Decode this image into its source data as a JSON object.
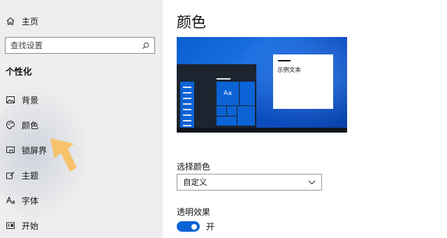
{
  "sidebar": {
    "home_label": "主页",
    "search": {
      "placeholder": "查找设置",
      "value": ""
    },
    "section_title": "个性化",
    "items": [
      {
        "label": "背景",
        "icon": "image-icon"
      },
      {
        "label": "颜色",
        "icon": "palette-icon"
      },
      {
        "label": "锁屏界",
        "icon": "lock-screen-icon"
      },
      {
        "label": "主题",
        "icon": "brush-icon"
      },
      {
        "label": "字体",
        "icon": "font-icon"
      },
      {
        "label": "开始",
        "icon": "start-icon"
      }
    ]
  },
  "main": {
    "title": "颜色",
    "preview": {
      "sample_text": "示例文本",
      "tile_text": "Aa"
    },
    "choose_color": {
      "label": "选择颜色",
      "selected": "自定义"
    },
    "transparency": {
      "label": "透明效果",
      "state": "开",
      "on": true
    }
  },
  "colors": {
    "accent": "#0b63d6",
    "sidebar_bg": "#eeeeee",
    "arrow": "#f6c26b"
  }
}
